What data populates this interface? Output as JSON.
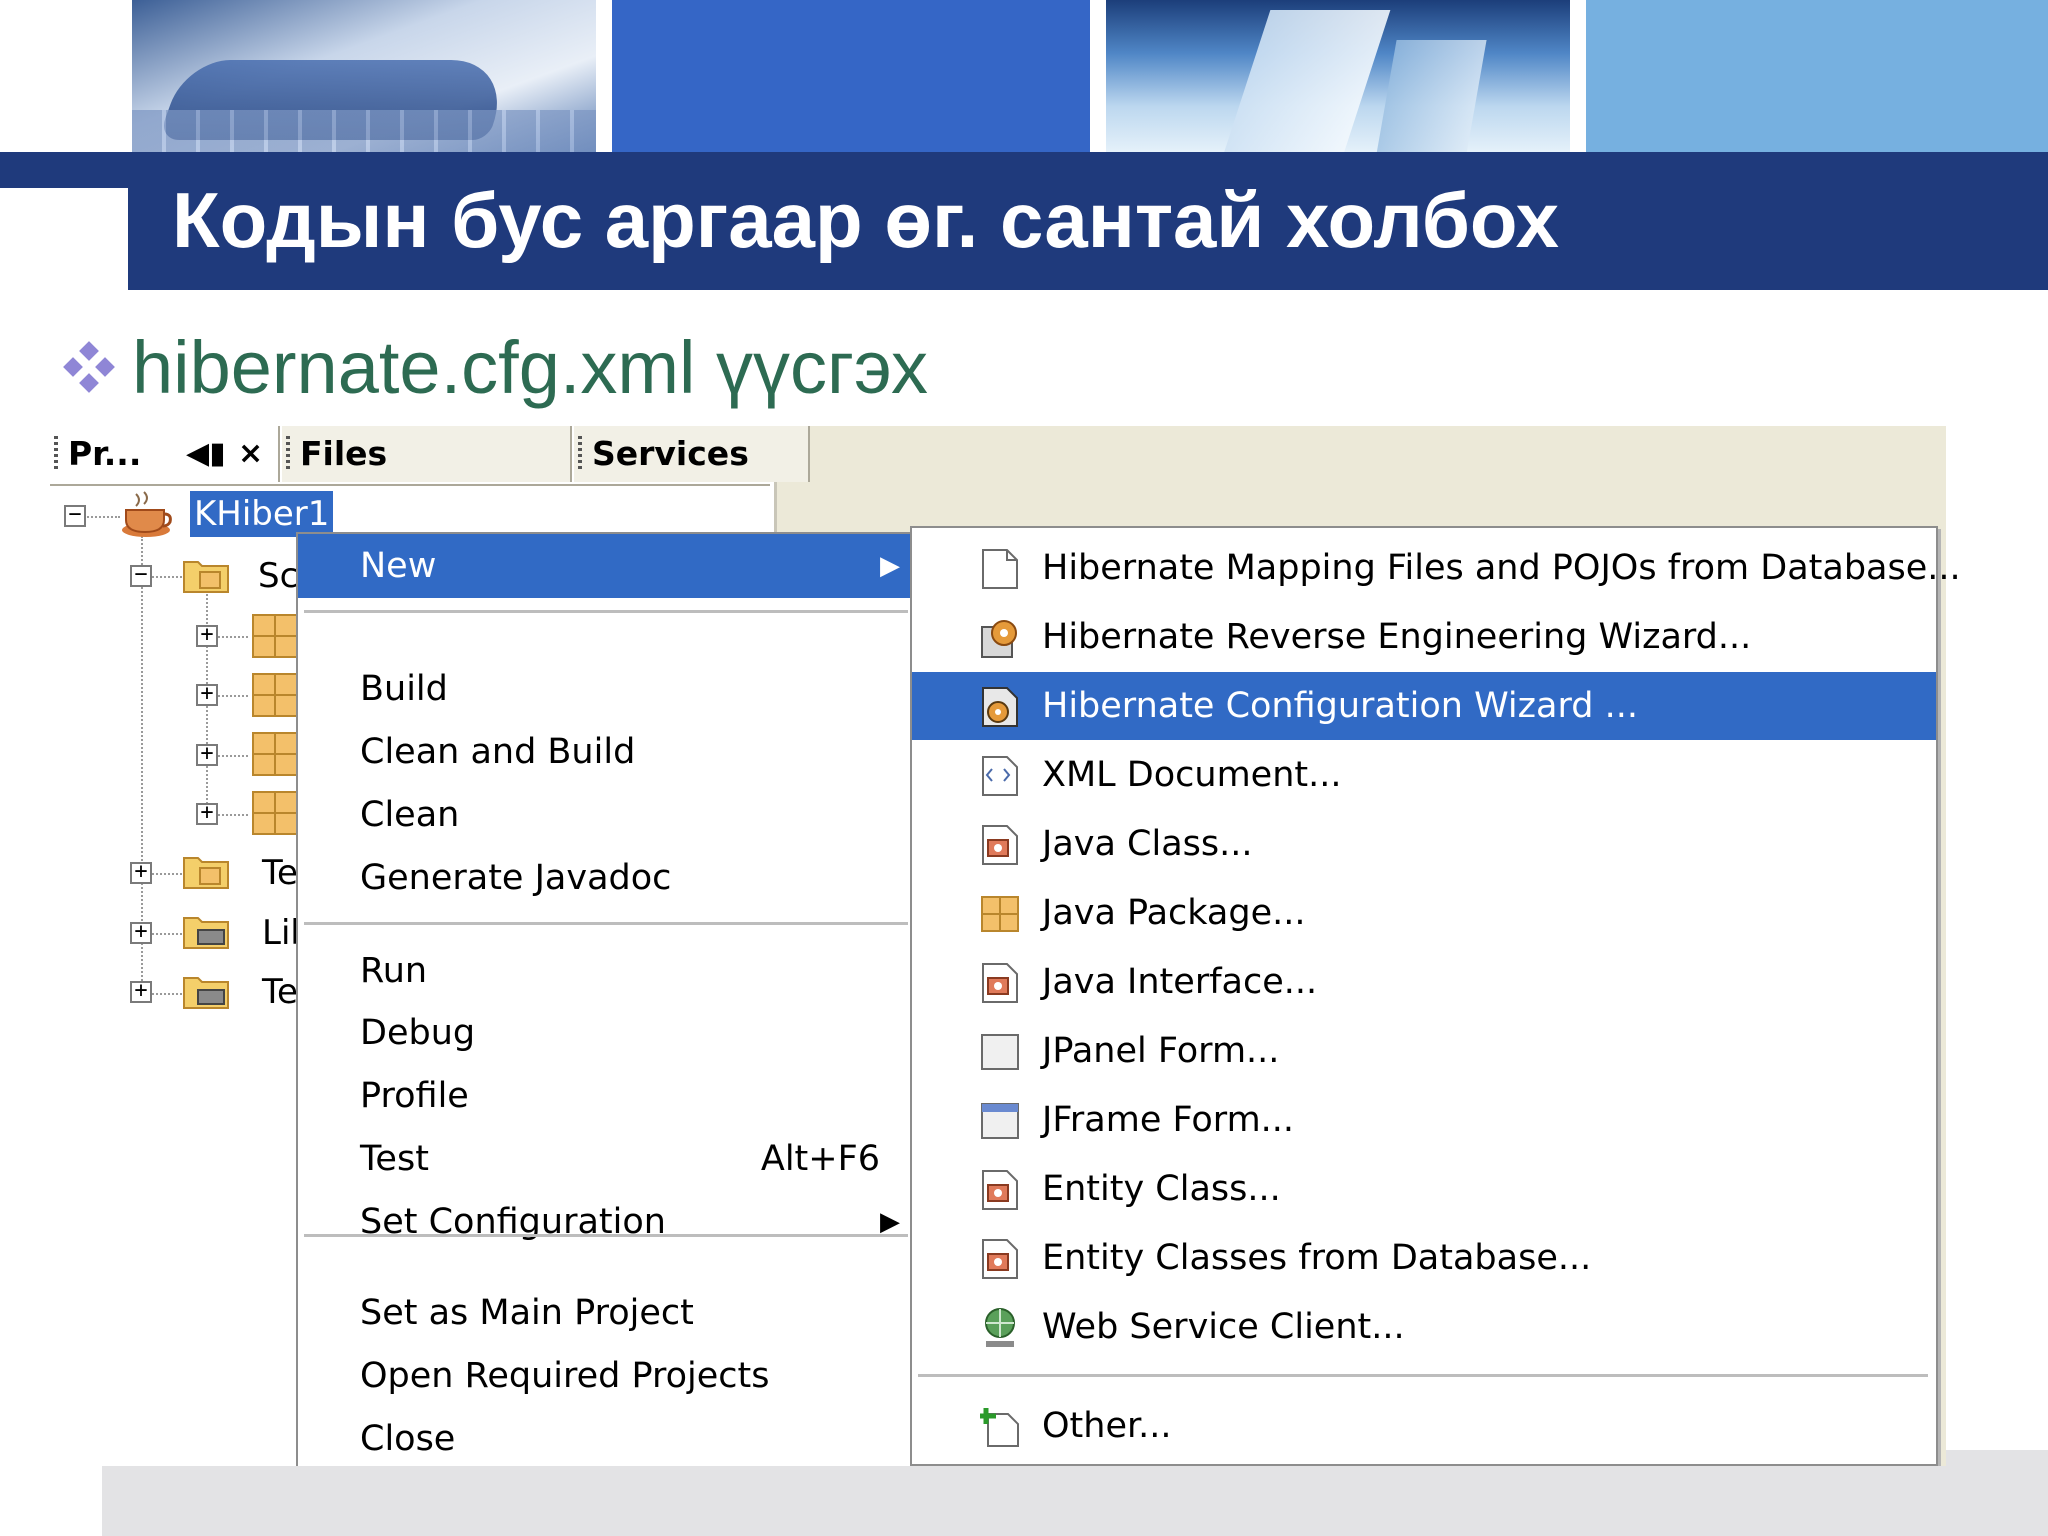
{
  "slide": {
    "title": "Кодын бус аргаар өг. сантай холбох",
    "bullet": "hibernate.cfg.xml үүсгэх"
  },
  "ide": {
    "tabs": {
      "projects": "Pr...",
      "files": "Files",
      "services": "Services"
    },
    "tree": {
      "project": "KHiber1",
      "source_packages": "Sc",
      "test_packages": "Te",
      "libraries": "Lib",
      "test_libraries": "Te"
    },
    "context_menu": {
      "new": "New",
      "build": "Build",
      "clean_and_build": "Clean and Build",
      "clean": "Clean",
      "generate_javadoc": "Generate Javadoc",
      "run": "Run",
      "debug": "Debug",
      "profile": "Profile",
      "test": "Test",
      "test_shortcut": "Alt+F6",
      "set_configuration": "Set Configuration",
      "set_as_main": "Set as Main Project",
      "open_required": "Open Required Projects",
      "close": "Close"
    },
    "submenu": {
      "mapping_files": "Hibernate Mapping Files and POJOs from Database...",
      "reverse_engineering": "Hibernate Reverse Engineering Wizard...",
      "configuration_wizard": "Hibernate Configuration Wizard ...",
      "xml_document": "XML Document...",
      "java_class": "Java Class...",
      "java_package": "Java Package...",
      "java_interface": "Java Interface...",
      "jpanel_form": "JPanel Form...",
      "jframe_form": "JFrame Form...",
      "entity_class": "Entity Class...",
      "entity_classes_db": "Entity Classes from Database...",
      "web_service_client": "Web Service Client...",
      "other": "Other..."
    }
  },
  "colors": {
    "title_bar": "#1f3a7c",
    "bullet_text": "#2d6b52",
    "selection": "#316ac5",
    "menu_bg": "#ffffff",
    "ide_bg": "#ece9d8"
  }
}
